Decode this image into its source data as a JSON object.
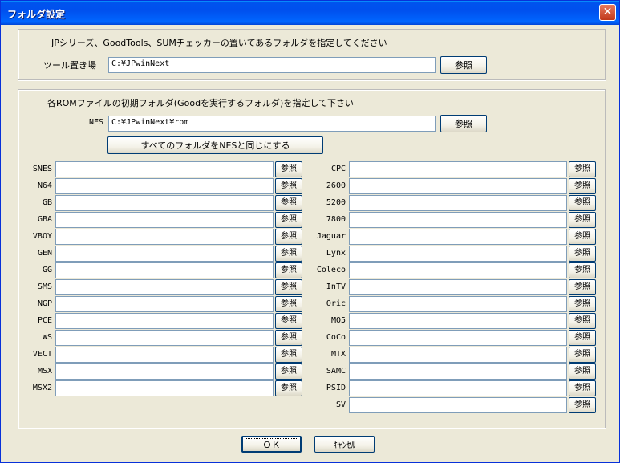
{
  "window": {
    "title": "フォルダ設定",
    "close": "✕"
  },
  "tool_group": {
    "description": "JPシリーズ、GoodTools、SUMチェッカーの置いてあるフォルダを指定してください",
    "label": "ツール置き場",
    "value": "C:¥JPwinNext",
    "browse": "参照"
  },
  "rom_group": {
    "description": "各ROMファイルの初期フォルダ(Goodを実行するフォルダ)を指定して下さい",
    "nes": {
      "label": "NES",
      "value": "C:¥JPwinNext¥rom",
      "browse": "参照"
    },
    "same_as_nes_button": "すべてのフォルダをNESと同じにする",
    "left_rows": [
      {
        "label": "SNES",
        "value": "",
        "browse": "参照"
      },
      {
        "label": "N64",
        "value": "",
        "browse": "参照"
      },
      {
        "label": "GB",
        "value": "",
        "browse": "参照"
      },
      {
        "label": "GBA",
        "value": "",
        "browse": "参照"
      },
      {
        "label": "VBOY",
        "value": "",
        "browse": "参照"
      },
      {
        "label": "GEN",
        "value": "",
        "browse": "参照"
      },
      {
        "label": "GG",
        "value": "",
        "browse": "参照"
      },
      {
        "label": "SMS",
        "value": "",
        "browse": "参照"
      },
      {
        "label": "NGP",
        "value": "",
        "browse": "参照"
      },
      {
        "label": "PCE",
        "value": "",
        "browse": "参照"
      },
      {
        "label": "WS",
        "value": "",
        "browse": "参照"
      },
      {
        "label": "VECT",
        "value": "",
        "browse": "参照"
      },
      {
        "label": "MSX",
        "value": "",
        "browse": "参照"
      },
      {
        "label": "MSX2",
        "value": "",
        "browse": "参照"
      }
    ],
    "right_rows": [
      {
        "label": "CPC",
        "value": "",
        "browse": "参照"
      },
      {
        "label": "2600",
        "value": "",
        "browse": "参照"
      },
      {
        "label": "5200",
        "value": "",
        "browse": "参照"
      },
      {
        "label": "7800",
        "value": "",
        "browse": "参照"
      },
      {
        "label": "Jaguar",
        "value": "",
        "browse": "参照"
      },
      {
        "label": "Lynx",
        "value": "",
        "browse": "参照"
      },
      {
        "label": "Coleco",
        "value": "",
        "browse": "参照"
      },
      {
        "label": "InTV",
        "value": "",
        "browse": "参照"
      },
      {
        "label": "Oric",
        "value": "",
        "browse": "参照"
      },
      {
        "label": "MO5",
        "value": "",
        "browse": "参照"
      },
      {
        "label": "CoCo",
        "value": "",
        "browse": "参照"
      },
      {
        "label": "MTX",
        "value": "",
        "browse": "参照"
      },
      {
        "label": "SAMC",
        "value": "",
        "browse": "参照"
      },
      {
        "label": "PSID",
        "value": "",
        "browse": "参照"
      },
      {
        "label": "SV",
        "value": "",
        "browse": "参照"
      }
    ]
  },
  "footer": {
    "ok": "ＯＫ",
    "cancel": "ｷｬﾝｾﾙ"
  }
}
